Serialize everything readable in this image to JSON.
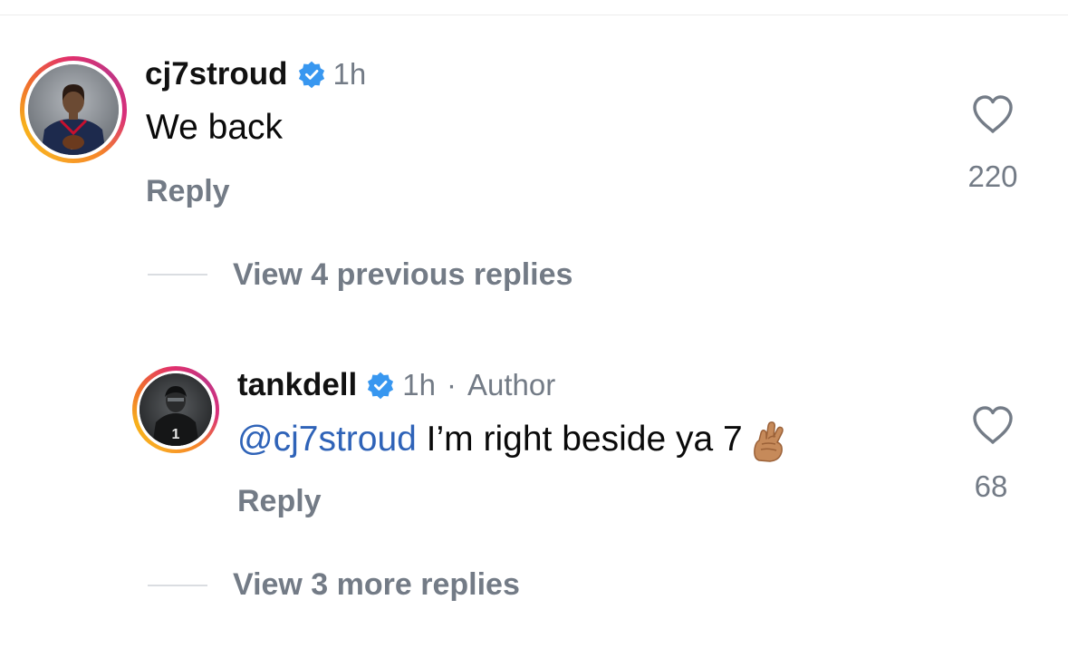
{
  "comments": [
    {
      "username": "cj7stroud",
      "verified": true,
      "time": "1h",
      "text": "We back",
      "reply_label": "Reply",
      "likes": "220",
      "view_replies_label": "View 4 previous replies"
    },
    {
      "username": "tankdell",
      "verified": true,
      "time": "1h",
      "separator": "·",
      "author_tag": "Author",
      "mention": "@cj7stroud",
      "text": " I’m right beside ya 7",
      "emoji": "🤞🏽",
      "reply_label": "Reply",
      "likes": "68",
      "view_replies_label": "View 3 more replies"
    }
  ],
  "colors": {
    "verified_blue": "#3897f0",
    "mention_blue": "#2f63b8",
    "secondary_text": "#737b86",
    "divider": "#dadde1"
  },
  "icons": {
    "verified": "verified-badge-icon",
    "like": "heart-outline-icon"
  }
}
